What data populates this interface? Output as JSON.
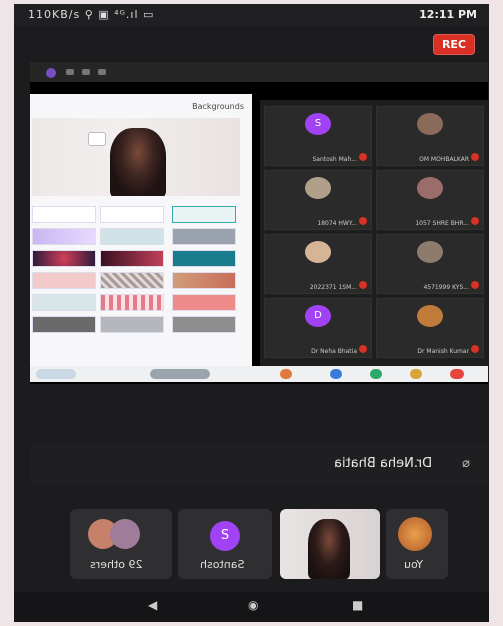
{
  "status_bar": {
    "left_text": "110KB/s ⚲ ▣ ⁴ᴳ.ıl ▭",
    "time": "12:11 PM"
  },
  "rec_label": "REC",
  "shared_screen": {
    "panel_title": "Backgrounds"
  },
  "participants_grid": [
    {
      "name": "Santosh Mah...",
      "initial": "S",
      "color": "#a142f4"
    },
    {
      "name": "OM MOHBALKAR",
      "initial": "",
      "color": "#8a6b5a"
    },
    {
      "name": "18074 HWY...",
      "initial": "",
      "color": "#b0a08a"
    },
    {
      "name": "1057 SHRE BHR...",
      "initial": "",
      "color": "#9a6c6a"
    },
    {
      "name": "2022371 1SM...",
      "initial": "",
      "color": "#d6b596"
    },
    {
      "name": "4571999 KYS...",
      "initial": "",
      "color": "#8d7b6b"
    },
    {
      "name": "Dr Neha Bhatia",
      "initial": "D",
      "color": "#a142f4"
    },
    {
      "name": "Dr Manish Kumar",
      "initial": "",
      "color": "#c07a3a"
    }
  ],
  "speaker": {
    "name": "Dr.Neha Bhatia"
  },
  "thumbnails": {
    "others_label": "29 others",
    "santosh_label": "Santosh",
    "santosh_initial": "S",
    "you_label": "You"
  },
  "nav": {
    "back": "◀",
    "home": "◉",
    "recents": "■"
  },
  "colors": {
    "rec": "#d93025",
    "accent_purple": "#a142f4",
    "background": "#1c1c1e"
  }
}
